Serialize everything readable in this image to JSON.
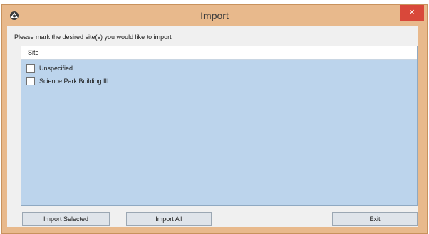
{
  "window": {
    "title": "Import",
    "close_label": "×",
    "accent_color": "#e8b98c",
    "close_color": "#d9483a",
    "icon": "app-icon"
  },
  "dialog": {
    "prompt": "Please mark the desired site(s) you would like to import"
  },
  "list": {
    "header": "Site",
    "items": [
      {
        "label": "Unspecified",
        "checked": false
      },
      {
        "label": "Science Park Building III",
        "checked": false
      }
    ]
  },
  "buttons": {
    "import_selected": "Import Selected",
    "import_all": "Import All",
    "exit": "Exit"
  }
}
